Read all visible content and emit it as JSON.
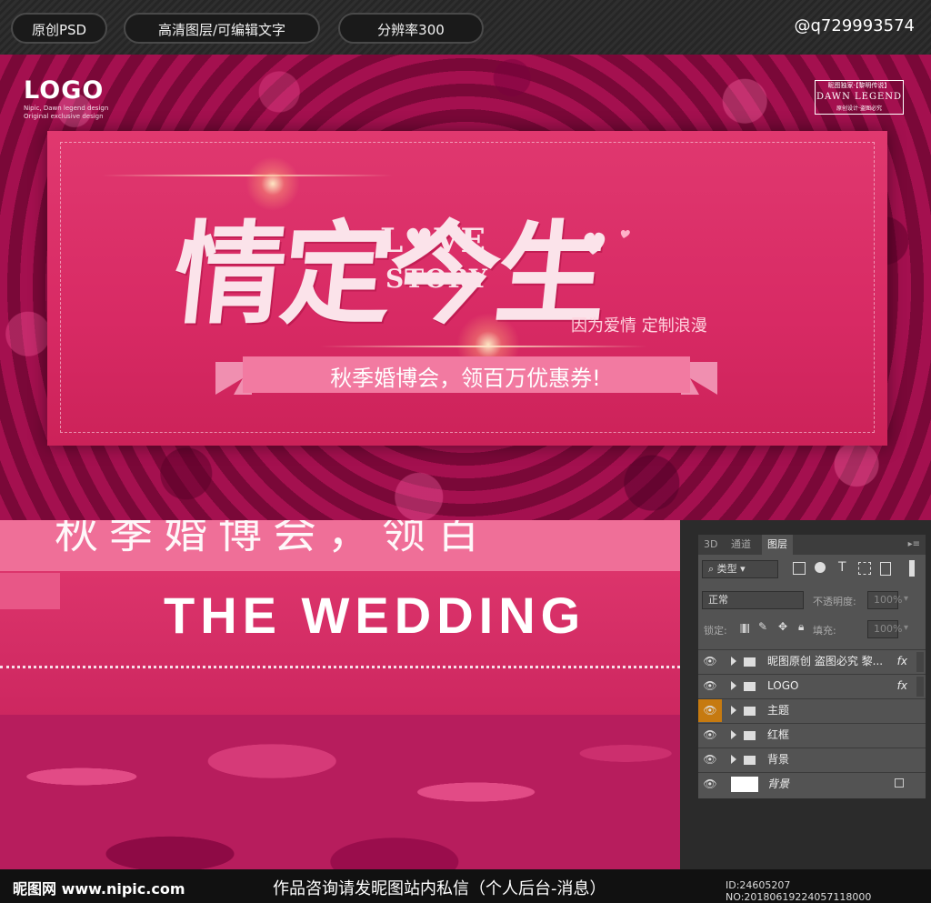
{
  "topbar": {
    "pill1": "原创PSD",
    "pill2": "高清图层/可编辑文字",
    "pill3": "分辨率300",
    "handle": "@q729993574"
  },
  "banner": {
    "logo": "LOGO",
    "logo_sub1": "Nipic, Dawn legend design",
    "logo_sub2": "Original exclusive design",
    "brand_top": "昵图独家·【黎明传说】",
    "brand_main": "DAWN LEGEND",
    "brand_bottom": "原创设计·盗图必究",
    "title": "情定今生",
    "love": "L♥VE",
    "story": "STORY",
    "subtitle": "因为爱情  定制浪漫",
    "ribbon_text": "秋季婚博会，领百万优惠券!"
  },
  "zoom": {
    "cut_text": "秋季婚博会，领百",
    "wedding": "THE WEDDING"
  },
  "ps": {
    "tabs": [
      "3D",
      "通道",
      "图层"
    ],
    "kind": "类型",
    "blend": "正常",
    "opacity_label": "不透明度:",
    "opacity_value": "100%",
    "lock_label": "锁定:",
    "fill_label": "填充:",
    "fill_value": "100%",
    "layers": [
      {
        "name": "昵图原创 盗图必究 黎...",
        "fx": "fx"
      },
      {
        "name": "LOGO",
        "fx": "fx"
      },
      {
        "name": "主题",
        "fx": ""
      },
      {
        "name": "红框",
        "fx": ""
      },
      {
        "name": "背景",
        "fx": ""
      },
      {
        "name": "背景",
        "fx": ""
      }
    ]
  },
  "bottombar": {
    "site": "昵图网 www.nipic.com",
    "message": "作品咨询请发昵图站内私信（个人后台-消息）",
    "id": "ID:24605207 NO:20180619224057118000"
  }
}
